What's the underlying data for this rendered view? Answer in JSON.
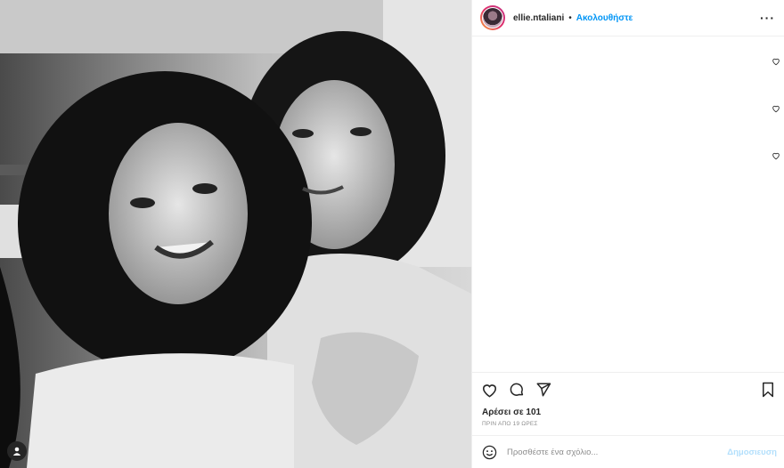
{
  "header": {
    "username": "ellie.ntaliani",
    "separator": "•",
    "follow_label": "Ακολουθήστε",
    "more_label": "···"
  },
  "post": {
    "likes_text": "Αρέσει σε 101",
    "time_text": "ΠΡΙΝ ΑΠΟ 19 ΩΡΕΣ"
  },
  "comment": {
    "placeholder": "Προσθέστε ένα σχόλιο...",
    "post_label": "Δημοσιευση"
  },
  "icons": {
    "like": "heart-icon",
    "comment": "comment-icon",
    "share": "paper-plane-icon",
    "save": "bookmark-icon",
    "emoji": "emoji-icon",
    "more": "more-icon",
    "user_tag": "user-tag-icon"
  },
  "colors": {
    "accent": "#0095f6",
    "post_disabled": "#b2dffc",
    "muted": "#8e8e8e",
    "text": "#262626"
  }
}
